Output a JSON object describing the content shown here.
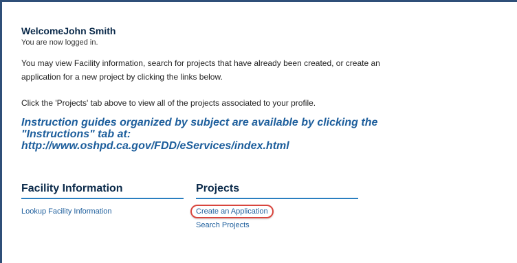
{
  "welcome": {
    "heading": "WelcomeJohn Smith",
    "status": "You are now logged in."
  },
  "intro": {
    "paragraph1": "You may view Facility information, search for projects that have already been created, or create an application for a new project by clicking the links below.",
    "paragraph2": "Click the 'Projects' tab above to view all of the projects associated to your profile."
  },
  "instructions": {
    "text": "Instruction guides organized by subject are available by clicking the \"Instructions\" tab at:",
    "link": "http://www.oshpd.ca.gov/FDD/eServices/index.html"
  },
  "facility": {
    "title": "Facility Information",
    "links": [
      "Lookup Facility Information"
    ]
  },
  "projects": {
    "title": "Projects",
    "links": [
      "Create an Application",
      "Search Projects"
    ]
  },
  "colors": {
    "heading": "#0b2a4a",
    "link": "#1d5e9c",
    "underline": "#2a7fc0",
    "highlight": "#d9453d"
  }
}
